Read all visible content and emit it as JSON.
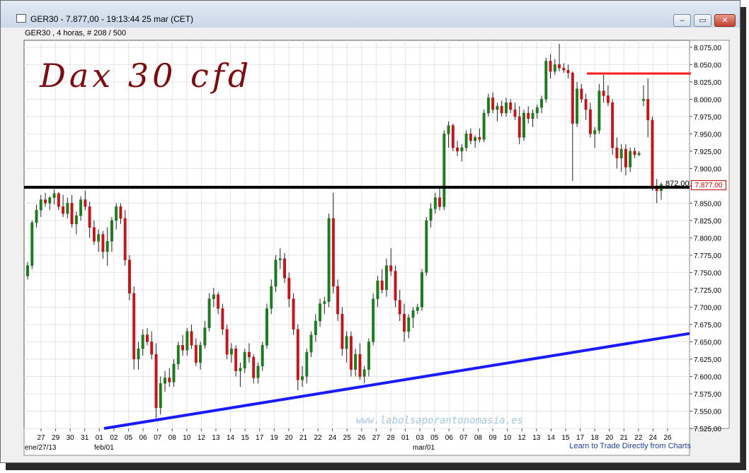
{
  "window": {
    "title": "GER30 - 7.877,00 - 19:13:44  25 mar (CET)",
    "subtitle": "GER30 , 4 horas, # 208 / 500",
    "controls": [
      "–",
      "▭",
      "✕"
    ]
  },
  "annotation": {
    "handwritten_title": "Dax 30 cfd",
    "marker_label": "872,00",
    "watermark": "www.labolsaporantonomasia.es",
    "footer_link": "Learn to Trade Directly from Charts"
  },
  "colors": {
    "bull": "#1f7a1f",
    "bear": "#c0161c",
    "support_line": "#1a1aff",
    "resistance_line": "#ff1a1a",
    "horizontal_line": "#000000"
  },
  "chart_data": {
    "type": "candlestick",
    "symbol": "GER30",
    "timeframe": "4 horas",
    "last_price": "7.877,00",
    "ylim": [
      7525,
      8085
    ],
    "y_ticks": [
      "8.075,00",
      "8.050,00",
      "8.025,00",
      "8.000,00",
      "7.975,00",
      "7.950,00",
      "7.925,00",
      "7.900,00",
      "7.875,00",
      "7.850,00",
      "7.825,00",
      "7.800,00",
      "7.775,00",
      "7.750,00",
      "7.725,00",
      "7.700,00",
      "7.675,00",
      "7.650,00",
      "7.625,00",
      "7.600,00",
      "7.575,00",
      "7.550,00",
      "7.525,00"
    ],
    "x_ticks": [
      "27",
      "29",
      "30",
      "31",
      "01",
      "02",
      "05",
      "06",
      "07",
      "08",
      "10",
      "12",
      "13",
      "14",
      "15",
      "17",
      "19",
      "20",
      "21",
      "22",
      "24",
      "25",
      "26",
      "27",
      "28",
      "01",
      "03",
      "05",
      "06",
      "07",
      "08",
      "09",
      "10",
      "12",
      "13",
      "14",
      "15",
      "17",
      "18",
      "20",
      "21",
      "22",
      "24",
      "26"
    ],
    "x_sublabels": [
      "ene/27/13",
      "feb/01",
      "mar/01"
    ],
    "lines": {
      "horizontal_support": 7873,
      "resistance": 8037,
      "trendline_start": 7525,
      "trendline_end": 7662
    },
    "candles": [
      {
        "o": 7745,
        "h": 7765,
        "l": 7740,
        "c": 7760
      },
      {
        "o": 7760,
        "h": 7825,
        "l": 7755,
        "c": 7822
      },
      {
        "o": 7822,
        "h": 7848,
        "l": 7815,
        "c": 7840
      },
      {
        "o": 7840,
        "h": 7862,
        "l": 7830,
        "c": 7855
      },
      {
        "o": 7855,
        "h": 7865,
        "l": 7845,
        "c": 7850
      },
      {
        "o": 7850,
        "h": 7860,
        "l": 7840,
        "c": 7858
      },
      {
        "o": 7858,
        "h": 7870,
        "l": 7848,
        "c": 7864
      },
      {
        "o": 7864,
        "h": 7866,
        "l": 7840,
        "c": 7845
      },
      {
        "o": 7845,
        "h": 7862,
        "l": 7830,
        "c": 7835
      },
      {
        "o": 7835,
        "h": 7858,
        "l": 7828,
        "c": 7850
      },
      {
        "o": 7850,
        "h": 7862,
        "l": 7815,
        "c": 7820
      },
      {
        "o": 7820,
        "h": 7838,
        "l": 7805,
        "c": 7832
      },
      {
        "o": 7832,
        "h": 7860,
        "l": 7825,
        "c": 7855
      },
      {
        "o": 7855,
        "h": 7868,
        "l": 7840,
        "c": 7845
      },
      {
        "o": 7845,
        "h": 7852,
        "l": 7800,
        "c": 7815
      },
      {
        "o": 7815,
        "h": 7825,
        "l": 7790,
        "c": 7795
      },
      {
        "o": 7795,
        "h": 7812,
        "l": 7780,
        "c": 7805
      },
      {
        "o": 7805,
        "h": 7810,
        "l": 7770,
        "c": 7780
      },
      {
        "o": 7780,
        "h": 7815,
        "l": 7760,
        "c": 7795
      },
      {
        "o": 7795,
        "h": 7830,
        "l": 7780,
        "c": 7825
      },
      {
        "o": 7825,
        "h": 7850,
        "l": 7812,
        "c": 7845
      },
      {
        "o": 7845,
        "h": 7850,
        "l": 7820,
        "c": 7828
      },
      {
        "o": 7828,
        "h": 7840,
        "l": 7760,
        "c": 7768
      },
      {
        "o": 7768,
        "h": 7775,
        "l": 7710,
        "c": 7720
      },
      {
        "o": 7720,
        "h": 7730,
        "l": 7610,
        "c": 7625
      },
      {
        "o": 7625,
        "h": 7650,
        "l": 7610,
        "c": 7640
      },
      {
        "o": 7640,
        "h": 7668,
        "l": 7630,
        "c": 7660
      },
      {
        "o": 7660,
        "h": 7670,
        "l": 7645,
        "c": 7650
      },
      {
        "o": 7650,
        "h": 7665,
        "l": 7625,
        "c": 7632
      },
      {
        "o": 7632,
        "h": 7648,
        "l": 7540,
        "c": 7555
      },
      {
        "o": 7555,
        "h": 7600,
        "l": 7545,
        "c": 7590
      },
      {
        "o": 7590,
        "h": 7608,
        "l": 7578,
        "c": 7598
      },
      {
        "o": 7598,
        "h": 7612,
        "l": 7585,
        "c": 7592
      },
      {
        "o": 7592,
        "h": 7625,
        "l": 7585,
        "c": 7618
      },
      {
        "o": 7618,
        "h": 7650,
        "l": 7610,
        "c": 7645
      },
      {
        "o": 7645,
        "h": 7660,
        "l": 7630,
        "c": 7638
      },
      {
        "o": 7638,
        "h": 7670,
        "l": 7630,
        "c": 7665
      },
      {
        "o": 7665,
        "h": 7675,
        "l": 7640,
        "c": 7645
      },
      {
        "o": 7645,
        "h": 7655,
        "l": 7615,
        "c": 7620
      },
      {
        "o": 7620,
        "h": 7650,
        "l": 7610,
        "c": 7645
      },
      {
        "o": 7645,
        "h": 7680,
        "l": 7640,
        "c": 7670
      },
      {
        "o": 7670,
        "h": 7720,
        "l": 7665,
        "c": 7712
      },
      {
        "o": 7712,
        "h": 7728,
        "l": 7700,
        "c": 7718
      },
      {
        "o": 7718,
        "h": 7722,
        "l": 7690,
        "c": 7698
      },
      {
        "o": 7698,
        "h": 7705,
        "l": 7660,
        "c": 7668
      },
      {
        "o": 7668,
        "h": 7675,
        "l": 7625,
        "c": 7632
      },
      {
        "o": 7632,
        "h": 7648,
        "l": 7620,
        "c": 7640
      },
      {
        "o": 7640,
        "h": 7645,
        "l": 7600,
        "c": 7608
      },
      {
        "o": 7608,
        "h": 7620,
        "l": 7585,
        "c": 7612
      },
      {
        "o": 7612,
        "h": 7640,
        "l": 7605,
        "c": 7635
      },
      {
        "o": 7635,
        "h": 7648,
        "l": 7620,
        "c": 7628
      },
      {
        "o": 7628,
        "h": 7632,
        "l": 7590,
        "c": 7598
      },
      {
        "o": 7598,
        "h": 7620,
        "l": 7590,
        "c": 7615
      },
      {
        "o": 7615,
        "h": 7650,
        "l": 7608,
        "c": 7645
      },
      {
        "o": 7645,
        "h": 7705,
        "l": 7640,
        "c": 7698
      },
      {
        "o": 7698,
        "h": 7740,
        "l": 7690,
        "c": 7730
      },
      {
        "o": 7730,
        "h": 7775,
        "l": 7722,
        "c": 7768
      },
      {
        "o": 7768,
        "h": 7785,
        "l": 7755,
        "c": 7770
      },
      {
        "o": 7770,
        "h": 7778,
        "l": 7735,
        "c": 7742
      },
      {
        "o": 7742,
        "h": 7750,
        "l": 7700,
        "c": 7712
      },
      {
        "o": 7712,
        "h": 7720,
        "l": 7660,
        "c": 7668
      },
      {
        "o": 7668,
        "h": 7675,
        "l": 7580,
        "c": 7595
      },
      {
        "o": 7595,
        "h": 7615,
        "l": 7585,
        "c": 7600
      },
      {
        "o": 7600,
        "h": 7640,
        "l": 7590,
        "c": 7635
      },
      {
        "o": 7635,
        "h": 7665,
        "l": 7628,
        "c": 7660
      },
      {
        "o": 7660,
        "h": 7690,
        "l": 7650,
        "c": 7680
      },
      {
        "o": 7680,
        "h": 7712,
        "l": 7672,
        "c": 7705
      },
      {
        "o": 7705,
        "h": 7715,
        "l": 7690,
        "c": 7708
      },
      {
        "o": 7708,
        "h": 7835,
        "l": 7700,
        "c": 7828
      },
      {
        "o": 7828,
        "h": 7865,
        "l": 7720,
        "c": 7730
      },
      {
        "o": 7730,
        "h": 7740,
        "l": 7680,
        "c": 7690
      },
      {
        "o": 7690,
        "h": 7700,
        "l": 7630,
        "c": 7640
      },
      {
        "o": 7640,
        "h": 7665,
        "l": 7620,
        "c": 7658
      },
      {
        "o": 7658,
        "h": 7665,
        "l": 7600,
        "c": 7610
      },
      {
        "o": 7610,
        "h": 7640,
        "l": 7600,
        "c": 7632
      },
      {
        "o": 7632,
        "h": 7648,
        "l": 7595,
        "c": 7600
      },
      {
        "o": 7600,
        "h": 7615,
        "l": 7590,
        "c": 7610
      },
      {
        "o": 7610,
        "h": 7655,
        "l": 7600,
        "c": 7650
      },
      {
        "o": 7650,
        "h": 7720,
        "l": 7645,
        "c": 7712
      },
      {
        "o": 7712,
        "h": 7745,
        "l": 7700,
        "c": 7738
      },
      {
        "o": 7738,
        "h": 7755,
        "l": 7720,
        "c": 7725
      },
      {
        "o": 7725,
        "h": 7770,
        "l": 7715,
        "c": 7760
      },
      {
        "o": 7760,
        "h": 7785,
        "l": 7745,
        "c": 7752
      },
      {
        "o": 7752,
        "h": 7760,
        "l": 7700,
        "c": 7710
      },
      {
        "o": 7710,
        "h": 7725,
        "l": 7680,
        "c": 7690
      },
      {
        "o": 7690,
        "h": 7705,
        "l": 7650,
        "c": 7665
      },
      {
        "o": 7665,
        "h": 7690,
        "l": 7655,
        "c": 7685
      },
      {
        "o": 7685,
        "h": 7700,
        "l": 7670,
        "c": 7695
      },
      {
        "o": 7695,
        "h": 7705,
        "l": 7690,
        "c": 7700
      },
      {
        "o": 7700,
        "h": 7755,
        "l": 7695,
        "c": 7750
      },
      {
        "o": 7750,
        "h": 7830,
        "l": 7745,
        "c": 7825
      },
      {
        "o": 7825,
        "h": 7850,
        "l": 7815,
        "c": 7842
      },
      {
        "o": 7842,
        "h": 7865,
        "l": 7835,
        "c": 7858
      },
      {
        "o": 7858,
        "h": 7875,
        "l": 7840,
        "c": 7845
      },
      {
        "o": 7845,
        "h": 7955,
        "l": 7840,
        "c": 7950
      },
      {
        "o": 7950,
        "h": 7968,
        "l": 7930,
        "c": 7962
      },
      {
        "o": 7962,
        "h": 7965,
        "l": 7925,
        "c": 7930
      },
      {
        "o": 7930,
        "h": 7940,
        "l": 7918,
        "c": 7925
      },
      {
        "o": 7925,
        "h": 7935,
        "l": 7910,
        "c": 7930
      },
      {
        "o": 7930,
        "h": 7955,
        "l": 7925,
        "c": 7950
      },
      {
        "o": 7950,
        "h": 7958,
        "l": 7935,
        "c": 7940
      },
      {
        "o": 7940,
        "h": 7948,
        "l": 7930,
        "c": 7945
      },
      {
        "o": 7945,
        "h": 7958,
        "l": 7938,
        "c": 7942
      },
      {
        "o": 7942,
        "h": 7985,
        "l": 7938,
        "c": 7980
      },
      {
        "o": 7980,
        "h": 8008,
        "l": 7975,
        "c": 8002
      },
      {
        "o": 8002,
        "h": 8010,
        "l": 7980,
        "c": 7985
      },
      {
        "o": 7985,
        "h": 7995,
        "l": 7968,
        "c": 7990
      },
      {
        "o": 7990,
        "h": 7998,
        "l": 7975,
        "c": 7980
      },
      {
        "o": 7980,
        "h": 8002,
        "l": 7975,
        "c": 7995
      },
      {
        "o": 7995,
        "h": 8000,
        "l": 7980,
        "c": 7985
      },
      {
        "o": 7985,
        "h": 7995,
        "l": 7970,
        "c": 7975
      },
      {
        "o": 7975,
        "h": 7990,
        "l": 7935,
        "c": 7945
      },
      {
        "o": 7945,
        "h": 7985,
        "l": 7940,
        "c": 7980
      },
      {
        "o": 7980,
        "h": 7990,
        "l": 7965,
        "c": 7972
      },
      {
        "o": 7972,
        "h": 7985,
        "l": 7960,
        "c": 7980
      },
      {
        "o": 7980,
        "h": 7992,
        "l": 7972,
        "c": 7988
      },
      {
        "o": 7988,
        "h": 8005,
        "l": 7980,
        "c": 8000
      },
      {
        "o": 8000,
        "h": 8060,
        "l": 7995,
        "c": 8055
      },
      {
        "o": 8055,
        "h": 8065,
        "l": 8030,
        "c": 8040
      },
      {
        "o": 8040,
        "h": 8058,
        "l": 8035,
        "c": 8050
      },
      {
        "o": 8050,
        "h": 8080,
        "l": 8040,
        "c": 8045
      },
      {
        "o": 8045,
        "h": 8052,
        "l": 8038,
        "c": 8042
      },
      {
        "o": 8042,
        "h": 8050,
        "l": 8030,
        "c": 8038
      },
      {
        "o": 8038,
        "h": 8040,
        "l": 7882,
        "c": 7965
      },
      {
        "o": 7965,
        "h": 8025,
        "l": 7960,
        "c": 8015
      },
      {
        "o": 8015,
        "h": 8022,
        "l": 7995,
        "c": 8000
      },
      {
        "o": 8000,
        "h": 8008,
        "l": 7970,
        "c": 7985
      },
      {
        "o": 7985,
        "h": 7995,
        "l": 7945,
        "c": 7950
      },
      {
        "o": 7950,
        "h": 7960,
        "l": 7930,
        "c": 7955
      },
      {
        "o": 7955,
        "h": 8022,
        "l": 7950,
        "c": 8012
      },
      {
        "o": 8012,
        "h": 8035,
        "l": 7995,
        "c": 8005
      },
      {
        "o": 8005,
        "h": 8020,
        "l": 7990,
        "c": 7995
      },
      {
        "o": 7995,
        "h": 8000,
        "l": 7920,
        "c": 7930
      },
      {
        "o": 7930,
        "h": 7945,
        "l": 7900,
        "c": 7915
      },
      {
        "o": 7915,
        "h": 7935,
        "l": 7895,
        "c": 7928
      },
      {
        "o": 7928,
        "h": 7935,
        "l": 7890,
        "c": 7902
      },
      {
        "o": 7902,
        "h": 7930,
        "l": 7895,
        "c": 7925
      },
      {
        "o": 7925,
        "h": 7930,
        "l": 7915,
        "c": 7920
      },
      {
        "o": 7920,
        "h": 7925,
        "l": 7918,
        "c": 7922
      },
      {
        "o": 7998,
        "h": 8020,
        "l": 7990,
        "c": 8000
      },
      {
        "o": 8000,
        "h": 8030,
        "l": 7945,
        "c": 7970
      },
      {
        "o": 7970,
        "h": 7975,
        "l": 7868,
        "c": 7875
      },
      {
        "o": 7875,
        "h": 7885,
        "l": 7850,
        "c": 7868
      },
      {
        "o": 7868,
        "h": 7880,
        "l": 7855,
        "c": 7877
      }
    ]
  }
}
